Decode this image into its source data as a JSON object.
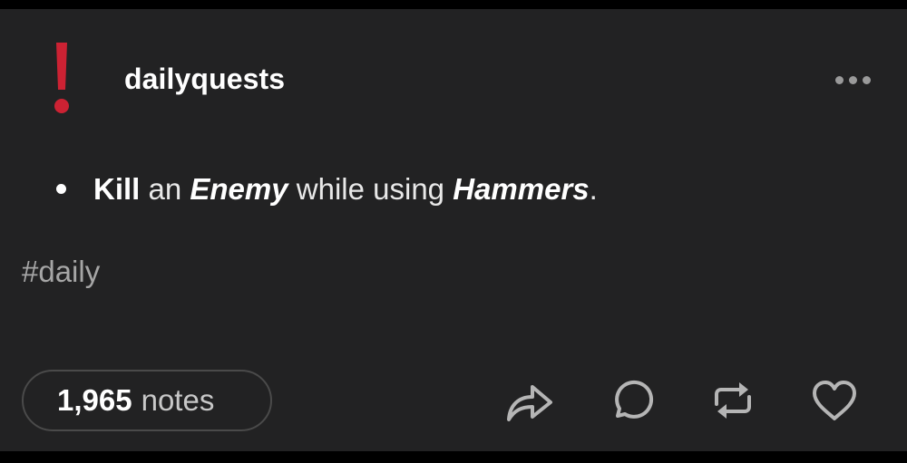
{
  "post": {
    "blog_name": "dailyquests",
    "body": {
      "w1": "Kill",
      "w2": " an ",
      "w3": "Enemy",
      "w4": " while using ",
      "w5": "Hammers",
      "w6": "."
    },
    "tags": [
      "#daily"
    ],
    "notes": {
      "count": "1,965",
      "label": "notes"
    }
  },
  "icons": {
    "avatar": "exclamation-mark-icon",
    "more": "more-horizontal-icon",
    "share": "share-arrow-icon",
    "reply": "speech-bubble-icon",
    "reblog": "reblog-icon",
    "like": "heart-icon"
  },
  "colors": {
    "background": "#222223",
    "avatar_red": "#cc2233",
    "icon_gray": "#b5b5b5"
  }
}
